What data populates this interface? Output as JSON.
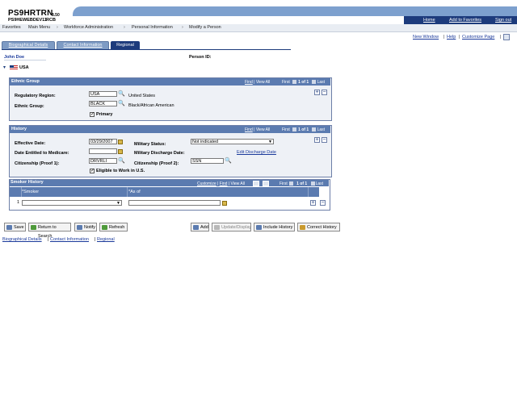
{
  "header": {
    "app_title": "PS9HRTRN",
    "version": "8.50",
    "database": "PS9HEWEBDEV11",
    "site": "RCB",
    "links": [
      "Home",
      "Add to Favorites",
      "Sign out"
    ]
  },
  "menu": {
    "items": [
      "Favorites",
      "Main Menu",
      "Workforce Administration",
      "Personal Information",
      "Modify a Person"
    ],
    "separator": "›"
  },
  "toolbar": {
    "links": [
      "New Window",
      "Help",
      "Customize Page"
    ]
  },
  "tabs": [
    {
      "label": "Biographical Details",
      "active": false
    },
    {
      "label": "Contact Information",
      "active": false
    },
    {
      "label": "Regional",
      "active": true
    }
  ],
  "person": {
    "name": "John Doe",
    "id_label": "Person ID:",
    "country": "USA"
  },
  "ethnic_group": {
    "title": "Ethnic Group",
    "nav": {
      "find": "Find",
      "view_all": "View All",
      "first": "First",
      "count": "1 of 1",
      "last": "Last"
    },
    "regulatory_region_label": "Regulatory Region:",
    "regulatory_region_value": "USA",
    "regulatory_region_desc": "United States",
    "ethnic_group_label": "Ethnic Group:",
    "ethnic_group_value": "BLACK",
    "ethnic_group_desc": "Black/African American",
    "primary_label": "Primary",
    "primary_checked": true
  },
  "history": {
    "title": "History",
    "nav": {
      "find": "Find",
      "view_all": "View All",
      "first": "First",
      "count": "1 of 1",
      "last": "Last"
    },
    "effective_date_label": "Effective Date:",
    "effective_date_value": "03/29/2007",
    "medicare_label": "Date Entitled to Medicare:",
    "medicare_value": "",
    "citizenship1_label": "Citizenship (Proof 1):",
    "citizenship1_value": "DRVRLI",
    "military_status_label": "Military Status:",
    "military_status_value": "Not indicated",
    "military_discharge_label": "Military Discharge Date:",
    "edit_discharge_link": "Edit Discharge Date",
    "citizenship2_label": "Citizenship (Proof 2):",
    "citizenship2_value": "SSN",
    "eligible_label": "Eligible to Work in U.S.",
    "eligible_checked": true
  },
  "smoker_history": {
    "title": "Smoker History",
    "nav": {
      "customize": "Customize",
      "find": "Find",
      "view_all": "View All",
      "first": "First",
      "count": "1 of 1",
      "last": "Last"
    },
    "columns": [
      "*Smoker",
      "*As of"
    ],
    "rows": [
      {
        "num": "1",
        "smoker": "",
        "as_of": ""
      }
    ]
  },
  "buttons": {
    "save": "Save",
    "return_to_search": "Return to Search",
    "notify": "Notify",
    "refresh": "Refresh",
    "add": "Add",
    "update_display": "Update/Display",
    "include_history": "Include History",
    "correct_history": "Correct History"
  },
  "footer_links": [
    "Biographical Details",
    "Contact Information",
    "Regional"
  ],
  "colors": {
    "accent": "#1d3b7c",
    "group_header": "#5b7bb0",
    "link": "#1b3a9b"
  }
}
